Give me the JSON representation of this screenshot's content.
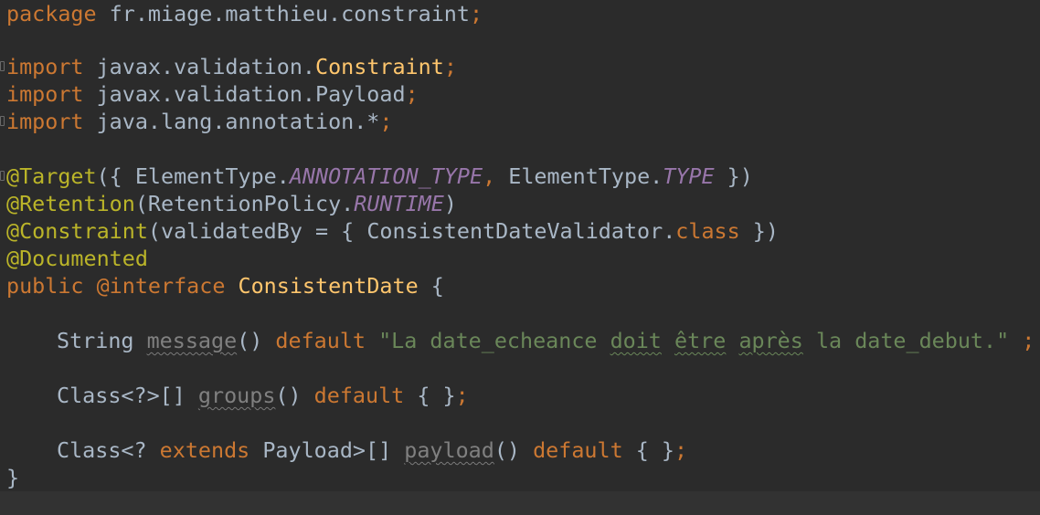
{
  "editor": {
    "language": "java",
    "colors": {
      "background": "#2b2b2b",
      "keyword": "#cc7832",
      "annotation": "#bbb529",
      "constant": "#9876aa",
      "string": "#6a8759",
      "text": "#a9b7c6",
      "unused": "#808080"
    },
    "lines": {
      "l1": {
        "kw": "package",
        "rest": " fr.miage.matthieu.constraint",
        "semi": ";"
      },
      "l3": {
        "kw": "import",
        "pkg": " javax.validation.",
        "cls": "Constraint",
        "semi": ";"
      },
      "l4": {
        "kw": "import",
        "pkg": " javax.validation.Payload",
        "semi": ";"
      },
      "l5": {
        "kw": "import",
        "pkg": " java.lang.annotation.*",
        "semi": ";"
      },
      "l7": {
        "ann": "@Target",
        "a": "({ ElementType.",
        "c1": "ANNOTATION_TYPE",
        "comma": ",",
        "b": " ElementType.",
        "c2": "TYPE",
        "end": " })"
      },
      "l8": {
        "ann": "@Retention",
        "a": "(RetentionPolicy.",
        "c1": "RUNTIME",
        "end": ")"
      },
      "l9": {
        "ann": "@Constraint",
        "a": "(",
        "param": "validatedBy",
        "b": " = { ConsistentDateValidator.",
        "kw": "class",
        "end": " })"
      },
      "l10": {
        "ann": "@Documented"
      },
      "l11": {
        "kw1": "public",
        "sp": " ",
        "kw2": "@interface",
        "sp2": " ",
        "name": "ConsistentDate",
        "end": " {"
      },
      "l13": {
        "type": "String ",
        "method": "message",
        "parens": "()",
        "kw": " default ",
        "s1": "\"La date_echeance ",
        "w1": "doit",
        "s2": " ",
        "w2": "être",
        "s3": " ",
        "w3": "après",
        "s4": " la date_debut.\"",
        "semi": " ;"
      },
      "l15": {
        "type": "Class<?>[] ",
        "method": "groups",
        "parens": "()",
        "kw": " default",
        "end": " { }",
        "semi": ";"
      },
      "l17": {
        "type": "Class<? ",
        "kw1": "extends",
        "type2": " Payload>[] ",
        "method": "payload",
        "parens": "()",
        "kw": " default",
        "end": " { }",
        "semi": ";"
      },
      "l18": {
        "brace": "}"
      }
    }
  }
}
